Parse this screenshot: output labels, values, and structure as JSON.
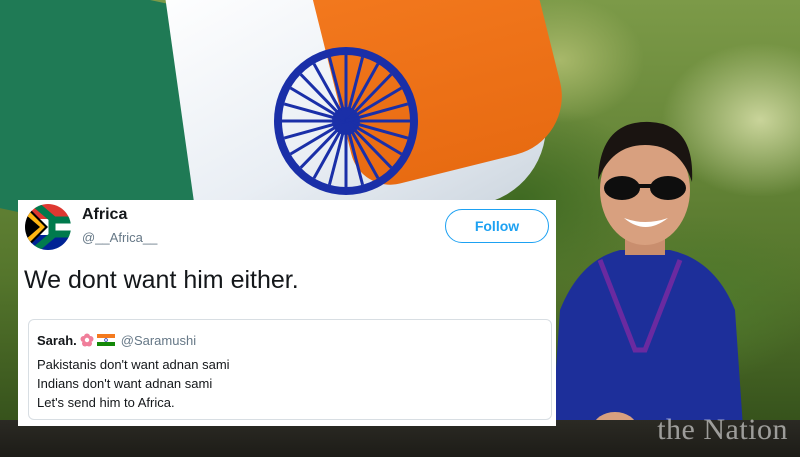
{
  "tweet": {
    "display_name": "Africa",
    "handle": "@__Africa__",
    "follow_label": "Follow",
    "text": "We dont want him either.",
    "avatar_icon": "south-africa-flag-icon"
  },
  "quoted_tweet": {
    "display_name": "Sarah.",
    "emojis": [
      "flower-icon",
      "india-flag-icon"
    ],
    "handle": "@Saramushi",
    "lines": [
      "Pakistanis don't want adnan sami",
      "Indians don't want adnan sami",
      "Let's send him to Africa."
    ]
  },
  "watermark": "the Nation",
  "colors": {
    "accent": "#1da1f2",
    "text": "#14171a",
    "secondary_text": "#657786",
    "flag_saffron": "#f47a1f",
    "flag_green": "#1f7a55",
    "chakra_blue": "#1a2fa8"
  }
}
